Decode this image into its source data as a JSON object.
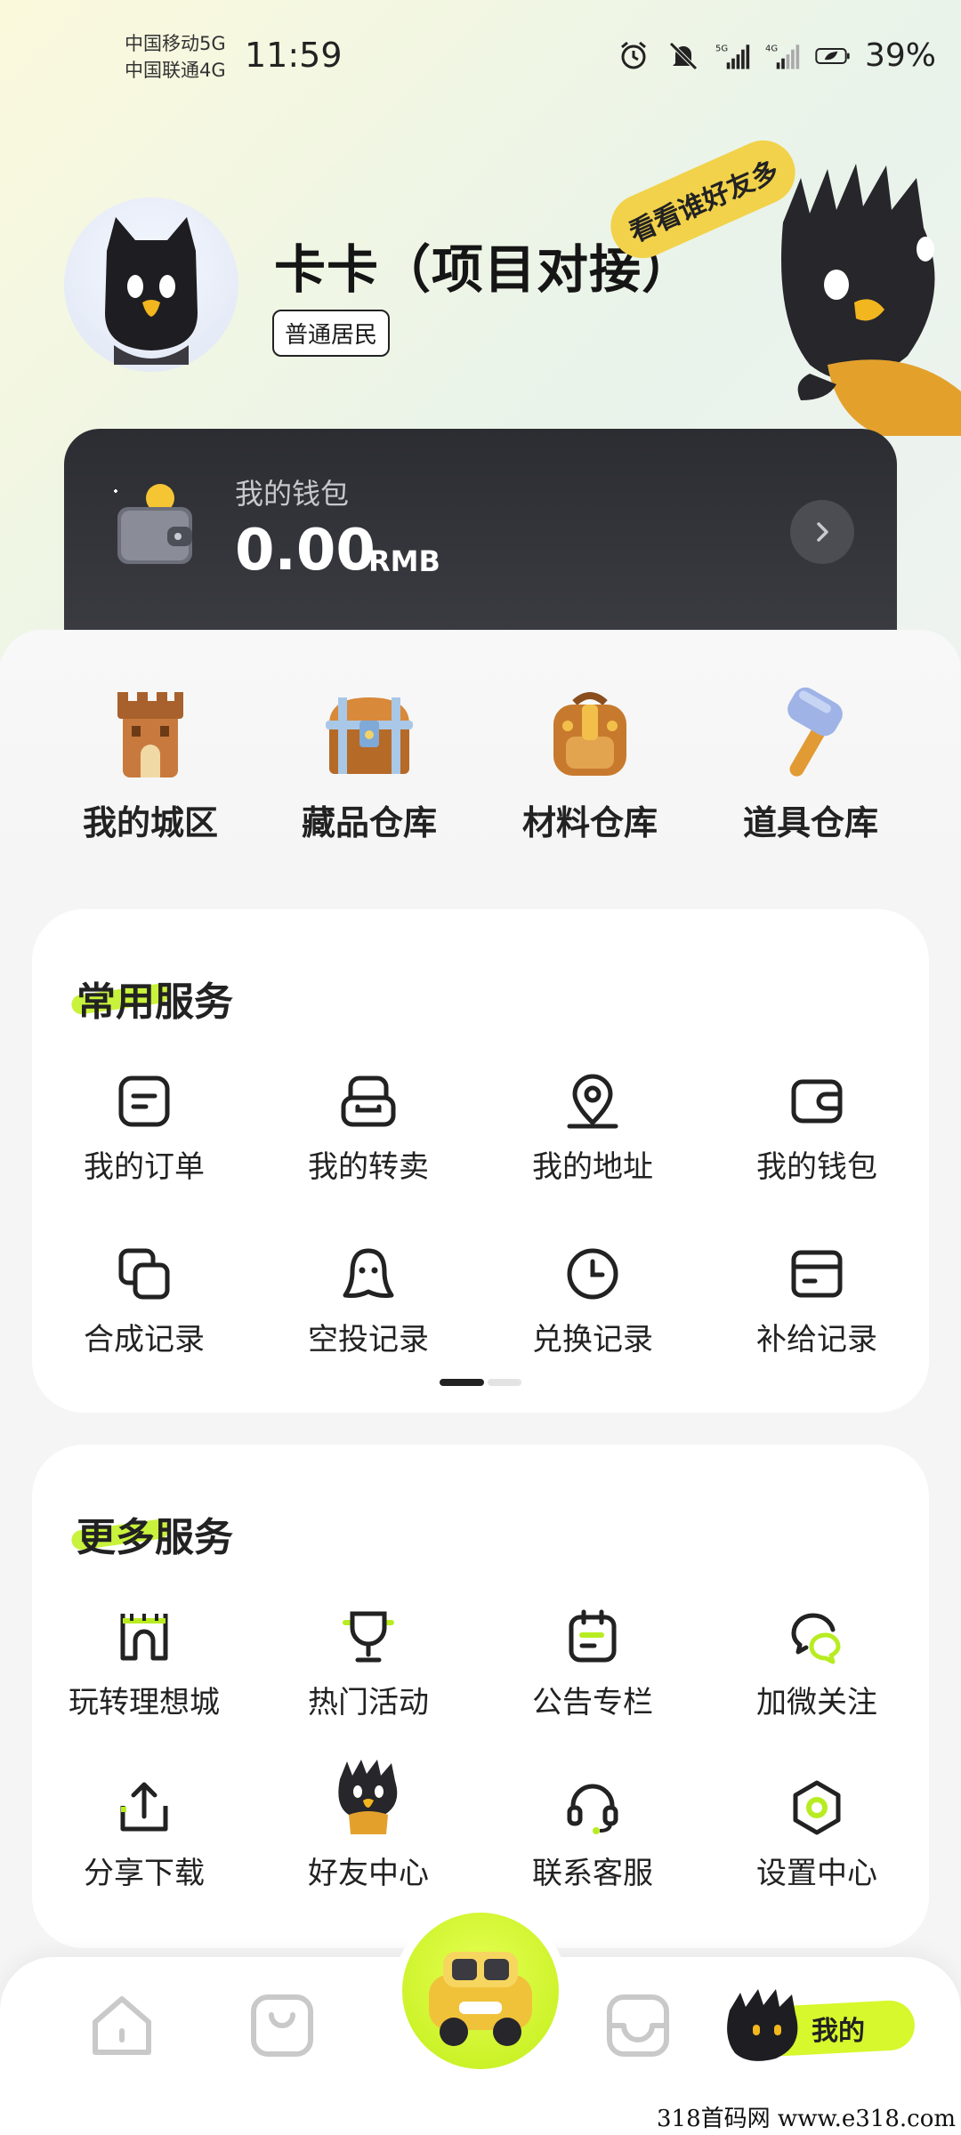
{
  "status_bar": {
    "carrier1": "中国移动5G",
    "carrier2": "中国联通4G",
    "time": "11:59",
    "battery": "39%"
  },
  "profile": {
    "name": "卡卡（项目对接）",
    "level_badge": "普通居民",
    "bubble": "看看谁好友多"
  },
  "wallet": {
    "title": "我的钱包",
    "amount": "0.00",
    "unit": "RMB"
  },
  "quick": [
    {
      "label": "我的城区",
      "icon": "castle-icon"
    },
    {
      "label": "藏品仓库",
      "icon": "chest-icon"
    },
    {
      "label": "材料仓库",
      "icon": "backpack-icon"
    },
    {
      "label": "道具仓库",
      "icon": "hammer-icon"
    }
  ],
  "common": {
    "title": "常用服务",
    "items": [
      {
        "label": "我的订单",
        "icon": "order-icon"
      },
      {
        "label": "我的转卖",
        "icon": "resell-icon"
      },
      {
        "label": "我的地址",
        "icon": "location-icon"
      },
      {
        "label": "我的钱包",
        "icon": "wallet-icon"
      },
      {
        "label": "合成记录",
        "icon": "copy-icon"
      },
      {
        "label": "空投记录",
        "icon": "ghost-icon"
      },
      {
        "label": "兑换记录",
        "icon": "clock-icon"
      },
      {
        "label": "补给记录",
        "icon": "card-icon"
      }
    ]
  },
  "more": {
    "title": "更多服务",
    "items": [
      {
        "label": "玩转理想城",
        "icon": "shop-icon"
      },
      {
        "label": "热门活动",
        "icon": "trophy-icon"
      },
      {
        "label": "公告专栏",
        "icon": "calendar-icon"
      },
      {
        "label": "加微关注",
        "icon": "wechat-icon"
      },
      {
        "label": "分享下载",
        "icon": "share-icon"
      },
      {
        "label": "好友中心",
        "icon": "friend-mascot-icon"
      },
      {
        "label": "联系客服",
        "icon": "headset-icon"
      },
      {
        "label": "设置中心",
        "icon": "settings-icon"
      }
    ]
  },
  "nav": {
    "mine_label": "我的"
  },
  "watermark": "318首码网  www.e318.com",
  "colors": {
    "accent": "#c9f23c",
    "wallet_bg": "#2c2d32",
    "bubble": "#f2d24a"
  }
}
